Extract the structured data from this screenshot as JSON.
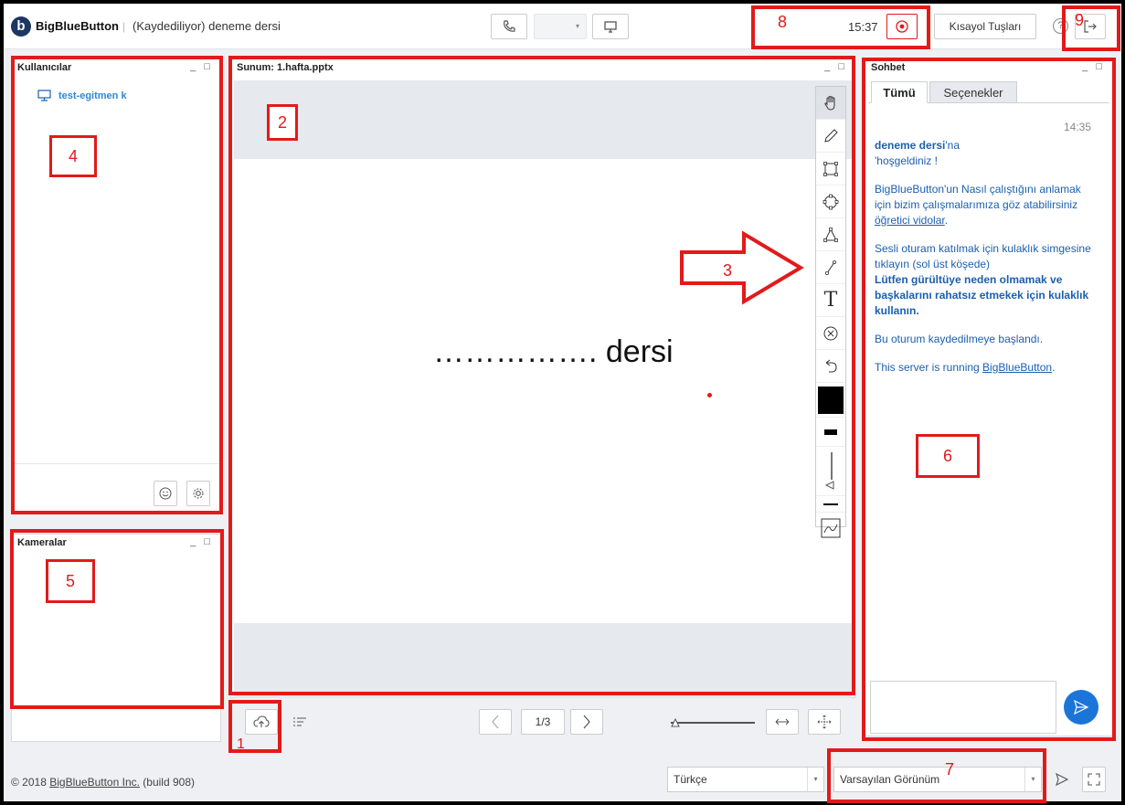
{
  "header": {
    "brand": "BigBlueButton",
    "separator": "|",
    "meeting_title": "(Kaydediliyor) deneme dersi",
    "clock": "15:37",
    "shortcuts_label": "Kısayol Tuşları",
    "help_label": "?",
    "icons": [
      "phone-icon",
      "dropdown-caret-icon",
      "desktop-share-icon",
      "record-icon",
      "help-icon",
      "logout-icon"
    ]
  },
  "users_panel": {
    "title": "Kullanıcılar",
    "controls": "_ □",
    "user": "test-egitmen k",
    "icons": [
      "presenter-icon",
      "emoji-status-icon",
      "settings-gear-icon"
    ]
  },
  "cameras_panel": {
    "title": "Kameralar",
    "controls": "_ □"
  },
  "presentation": {
    "title": "Sunum: 1.hafta.pptx",
    "controls": "_ □",
    "slide_text": "……………. dersi",
    "page": "1/3",
    "tools": [
      "hand-icon",
      "pencil-icon",
      "rectangle-icon",
      "ellipse-icon",
      "triangle-icon",
      "line-icon",
      "text-tool-icon",
      "clear-icon",
      "undo-icon",
      "color-picker-icon",
      "thickness-icon",
      "thickness-slider-icon",
      "chart-icon"
    ],
    "tool_text": "T"
  },
  "chat": {
    "title": "Sohbet",
    "controls": "_ □",
    "tab_all": "Tümü",
    "tab_options": "Seçenekler",
    "time": "14:35",
    "welcome_title": "deneme dersi",
    "welcome_suffix": "'na",
    "welcome_line2": "'hoşgeldiniz !",
    "msg1": "BigBlueButton'un Nasıl çalıştığını anlamak için bizim çalışmalarımıza göz atabilirsiniz ",
    "msg1_link": "öğretici vidolar",
    "msg1_end": ".",
    "msg2": " Sesli oturam katılmak için kulaklık simgesine tıklayın (sol üst köşede)",
    "msg2_bold": "Lütfen gürültüye neden olmamak ve başkalarını rahatsız etmekek için kulaklık kullanın.",
    "msg3": "Bu oturum kaydedilmeye başlandı.",
    "msg4": "This server is running ",
    "msg4_link": "BigBlueButton",
    "msg4_end": "."
  },
  "footer": {
    "copyright": "© 2018 ",
    "copyright_link": "BigBlueButton Inc.",
    "build": " (build 908)",
    "language": "Türkçe",
    "layout": "Varsayılan Görünüm"
  },
  "annotations": {
    "labels": [
      "1",
      "2",
      "3",
      "4",
      "5",
      "6",
      "7",
      "8",
      "9"
    ],
    "color": "#e21a1a"
  }
}
